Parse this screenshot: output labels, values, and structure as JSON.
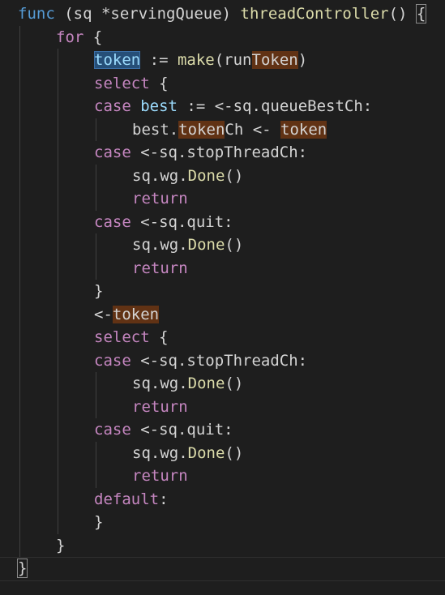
{
  "editor": {
    "colors": {
      "background": "#1e1e1e",
      "keyword": "#569cd6",
      "control": "#c586c0",
      "function": "#dcdcaa",
      "type": "#4ec9b0",
      "variable": "#9cdcfe",
      "plain": "#d4d4d4",
      "word_highlight": "#613214",
      "selection": "#264f78"
    },
    "lines": [
      {
        "indent": 0,
        "tokens": [
          {
            "t": "func",
            "c": "keyword"
          },
          {
            "t": " (sq *servingQueue) ",
            "c": "plain"
          },
          {
            "t": "threadController",
            "c": "function"
          },
          {
            "t": "() ",
            "c": "plain"
          },
          {
            "t": "{",
            "c": "plain",
            "brace": true
          }
        ]
      },
      {
        "indent": 1,
        "tokens": [
          {
            "t": "for",
            "c": "control"
          },
          {
            "t": " {",
            "c": "plain"
          }
        ]
      },
      {
        "indent": 2,
        "tokens": [
          {
            "t": "token",
            "c": "variable",
            "sel": true
          },
          {
            "t": " := ",
            "c": "plain"
          },
          {
            "t": "make",
            "c": "function"
          },
          {
            "t": "(run",
            "c": "plain"
          },
          {
            "t": "Token",
            "c": "plain",
            "hl": true
          },
          {
            "t": ")",
            "c": "plain"
          }
        ]
      },
      {
        "indent": 2,
        "tokens": [
          {
            "t": "select",
            "c": "control"
          },
          {
            "t": " {",
            "c": "plain"
          }
        ]
      },
      {
        "indent": 2,
        "tokens": [
          {
            "t": "case",
            "c": "control"
          },
          {
            "t": " ",
            "c": "plain"
          },
          {
            "t": "best",
            "c": "variable"
          },
          {
            "t": " := <-sq.queueBestCh:",
            "c": "plain"
          }
        ]
      },
      {
        "indent": 3,
        "tokens": [
          {
            "t": "best.",
            "c": "plain"
          },
          {
            "t": "token",
            "c": "plain",
            "hl": true
          },
          {
            "t": "Ch <- ",
            "c": "plain"
          },
          {
            "t": "token",
            "c": "plain",
            "hl": true
          }
        ]
      },
      {
        "indent": 2,
        "tokens": [
          {
            "t": "case",
            "c": "control"
          },
          {
            "t": " <-sq.stopThreadCh:",
            "c": "plain"
          }
        ]
      },
      {
        "indent": 3,
        "tokens": [
          {
            "t": "sq.wg.",
            "c": "plain"
          },
          {
            "t": "Done",
            "c": "function"
          },
          {
            "t": "()",
            "c": "plain"
          }
        ]
      },
      {
        "indent": 3,
        "tokens": [
          {
            "t": "return",
            "c": "control"
          }
        ]
      },
      {
        "indent": 2,
        "tokens": [
          {
            "t": "case",
            "c": "control"
          },
          {
            "t": " <-sq.quit:",
            "c": "plain"
          }
        ]
      },
      {
        "indent": 3,
        "tokens": [
          {
            "t": "sq.wg.",
            "c": "plain"
          },
          {
            "t": "Done",
            "c": "function"
          },
          {
            "t": "()",
            "c": "plain"
          }
        ]
      },
      {
        "indent": 3,
        "tokens": [
          {
            "t": "return",
            "c": "control"
          }
        ]
      },
      {
        "indent": 2,
        "tokens": [
          {
            "t": "}",
            "c": "plain"
          }
        ]
      },
      {
        "indent": 2,
        "tokens": [
          {
            "t": "<-",
            "c": "plain"
          },
          {
            "t": "token",
            "c": "plain",
            "hl": true
          }
        ]
      },
      {
        "indent": 2,
        "tokens": [
          {
            "t": "select",
            "c": "control"
          },
          {
            "t": " {",
            "c": "plain"
          }
        ]
      },
      {
        "indent": 2,
        "tokens": [
          {
            "t": "case",
            "c": "control"
          },
          {
            "t": " <-sq.stopThreadCh:",
            "c": "plain"
          }
        ]
      },
      {
        "indent": 3,
        "tokens": [
          {
            "t": "sq.wg.",
            "c": "plain"
          },
          {
            "t": "Done",
            "c": "function"
          },
          {
            "t": "()",
            "c": "plain"
          }
        ]
      },
      {
        "indent": 3,
        "tokens": [
          {
            "t": "return",
            "c": "control"
          }
        ]
      },
      {
        "indent": 2,
        "tokens": [
          {
            "t": "case",
            "c": "control"
          },
          {
            "t": " <-sq.quit:",
            "c": "plain"
          }
        ]
      },
      {
        "indent": 3,
        "tokens": [
          {
            "t": "sq.wg.",
            "c": "plain"
          },
          {
            "t": "Done",
            "c": "function"
          },
          {
            "t": "()",
            "c": "plain"
          }
        ]
      },
      {
        "indent": 3,
        "tokens": [
          {
            "t": "return",
            "c": "control"
          }
        ]
      },
      {
        "indent": 2,
        "tokens": [
          {
            "t": "default",
            "c": "control"
          },
          {
            "t": ":",
            "c": "plain"
          }
        ]
      },
      {
        "indent": 2,
        "tokens": [
          {
            "t": "}",
            "c": "plain"
          }
        ]
      },
      {
        "indent": 1,
        "tokens": [
          {
            "t": "}",
            "c": "plain"
          }
        ]
      },
      {
        "indent": 0,
        "tokens": [
          {
            "t": "}",
            "c": "plain",
            "brace": true
          }
        ]
      }
    ]
  }
}
